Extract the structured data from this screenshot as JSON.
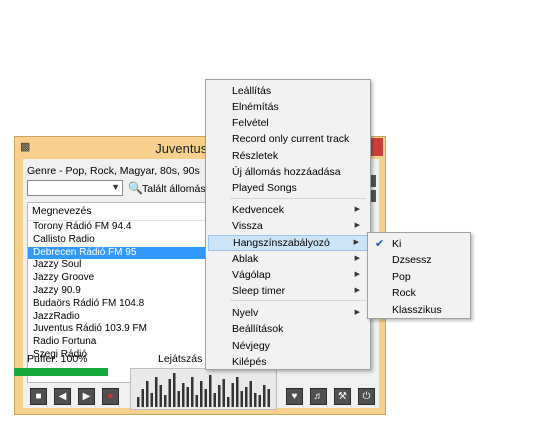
{
  "window": {
    "title": "Juventus Rádió",
    "genre": "Genre - Pop, Rock, Magyar, 80s, 90s",
    "found_label": "Talált állomások: 1",
    "list_header": "Megnevezés",
    "stations": [
      "Torony Rádió FM 94.4",
      "Callisto Radio",
      "Debrecen Rádió FM 95",
      "Jazzy Soul",
      "Jazzy Groove",
      "Jazzy 90.9",
      "Budaörs Rádió FM 104.8",
      "JazzRadio",
      "Juventus Rádió 103.9 FM",
      "Radio Fortuna",
      "Szegi Rádió"
    ],
    "selected_station_index": 2,
    "buffer_label": "Puffer: 100%",
    "buffer_percent": 100,
    "playing_label": "Lejátszás"
  },
  "menu": {
    "items": [
      {
        "label": "Leállítás"
      },
      {
        "label": "Elnémítás"
      },
      {
        "label": "Felvétel"
      },
      {
        "label": "Record only current track"
      },
      {
        "label": "Részletek"
      },
      {
        "label": "Új állomás hozzáadása"
      },
      {
        "label": "Played Songs"
      },
      {
        "label": "Kedvencek",
        "submenu": true
      },
      {
        "label": "Vissza",
        "submenu": true
      },
      {
        "label": "Hangszínszabályozó",
        "submenu": true,
        "highlighted": true
      },
      {
        "label": "Ablak",
        "submenu": true
      },
      {
        "label": "Vágólap",
        "submenu": true
      },
      {
        "label": "Sleep timer",
        "submenu": true
      },
      {
        "label": "Nyelv",
        "submenu": true
      },
      {
        "label": "Beállítások"
      },
      {
        "label": "Névjegy"
      },
      {
        "label": "Kilépés"
      }
    ]
  },
  "submenu": {
    "items": [
      {
        "label": "Ki",
        "checked": true
      },
      {
        "label": "Dzsessz"
      },
      {
        "label": "Pop"
      },
      {
        "label": "Rock"
      },
      {
        "label": "Klasszikus"
      }
    ]
  },
  "colors": {
    "window_frame": "#f6d08c",
    "selection": "#3399ff",
    "menu_highlight": "#cce4f7",
    "buffer_bar": "#18a83c"
  },
  "icons": {
    "transport": [
      "stop-icon",
      "prev-icon",
      "next-icon",
      "record-icon"
    ],
    "right": [
      "heart-icon",
      "volume-icon",
      "tools-icon",
      "power-icon"
    ]
  }
}
